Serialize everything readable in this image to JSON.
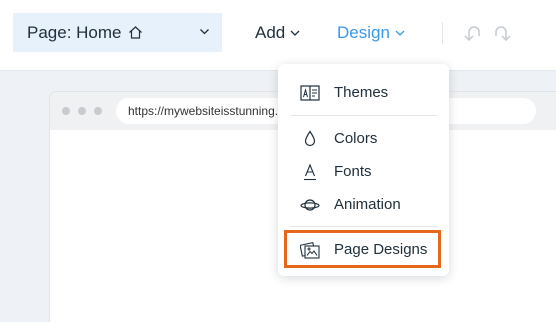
{
  "toolbar": {
    "page_selector_label": "Page: Home",
    "add_label": "Add",
    "design_label": "Design"
  },
  "browser": {
    "url": "https://mywebsiteisstunning.com"
  },
  "design_menu": {
    "items": [
      {
        "label": "Themes",
        "icon": "themes-icon"
      },
      {
        "label": "Colors",
        "icon": "droplet-icon"
      },
      {
        "label": "Fonts",
        "icon": "font-icon"
      },
      {
        "label": "Animation",
        "icon": "planet-icon"
      },
      {
        "label": "Page Designs",
        "icon": "page-designs-icon"
      }
    ]
  },
  "colors": {
    "accent": "#3899ec",
    "highlight_border": "#e5671c",
    "selector_bg": "#e7f1fb"
  }
}
